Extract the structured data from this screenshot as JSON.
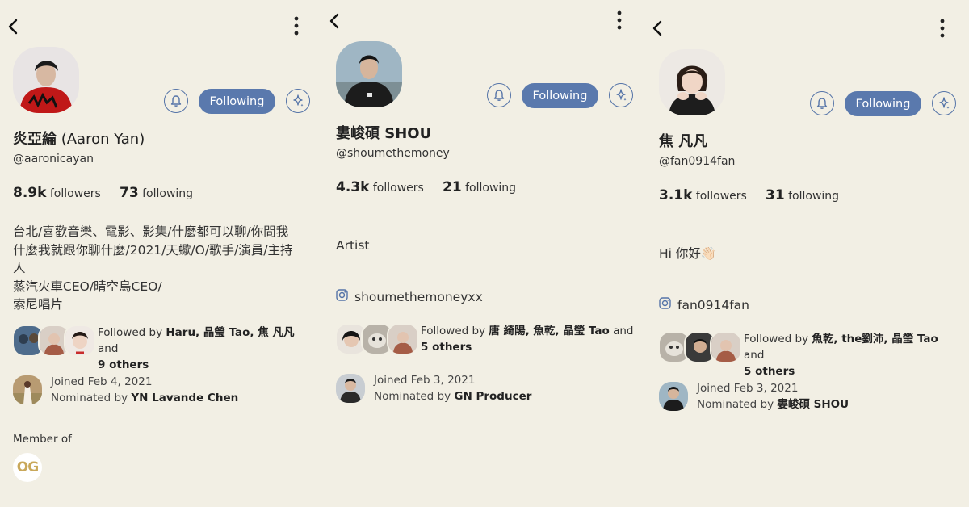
{
  "colors": {
    "background": "#f2efe4",
    "accent": "#5a79ad",
    "icon_outline": "#5574a8"
  },
  "icons": {
    "back": "chevron-left-icon",
    "more": "more-vertical-icon",
    "bell": "bell-icon",
    "sparkle": "sparkle-icon",
    "instagram": "instagram-icon"
  },
  "profiles": [
    {
      "name": "炎亞綸",
      "name_suffix": " (Aaron Yan)",
      "handle": "@aaronicayan",
      "followers_count": "8.9k",
      "followers_label": "followers",
      "following_count": "73",
      "following_label": "following",
      "follow_button": "Following",
      "bio": [
        "台北/喜歡音樂、電影、影集/什麼都可以聊/你問我",
        "什麼我就跟你聊什麼/2021/天蠍/O/歌手/演員/主持",
        "人",
        "蒸汽火車CEO/晴空鳥CEO/",
        "索尼唱片"
      ],
      "followed_by_prefix": "Followed by ",
      "followed_by_names": "Haru, 晶瑩 Tao, 焦 凡凡",
      "followed_by_and": " and",
      "followed_by_others": "9 others",
      "joined": "Joined Feb 4, 2021",
      "nominated_prefix": "Nominated by ",
      "nominated_by": "YN Lavande Chen",
      "member_of": "Member of",
      "club_badge": "OG"
    },
    {
      "name": "婁峻碩 SHOU",
      "handle": "@shoumethemoney",
      "followers_count": "4.3k",
      "followers_label": "followers",
      "following_count": "21",
      "following_label": "following",
      "follow_button": "Following",
      "bio": [
        "Artist"
      ],
      "instagram": "shoumethemoneyxx",
      "followed_by_prefix": "Followed by ",
      "followed_by_names": "唐 綺陽, 魚乾, 晶瑩 Tao",
      "followed_by_and": " and",
      "followed_by_others": "5 others",
      "joined": "Joined Feb 3, 2021",
      "nominated_prefix": "Nominated by ",
      "nominated_by": "GN Producer"
    },
    {
      "name": "焦 凡凡",
      "handle": "@fan0914fan",
      "followers_count": "3.1k",
      "followers_label": "followers",
      "following_count": "31",
      "following_label": "following",
      "follow_button": "Following",
      "bio": [
        "Hi 你好👋🏻"
      ],
      "instagram": "fan0914fan",
      "followed_by_prefix": "Followed by ",
      "followed_by_names": "魚乾, the劉沛, 晶瑩 Tao",
      "followed_by_and": " and",
      "followed_by_others": "5 others",
      "joined": "Joined Feb 3, 2021",
      "nominated_prefix": "Nominated by ",
      "nominated_by": "婁峻碩 SHOU"
    }
  ]
}
